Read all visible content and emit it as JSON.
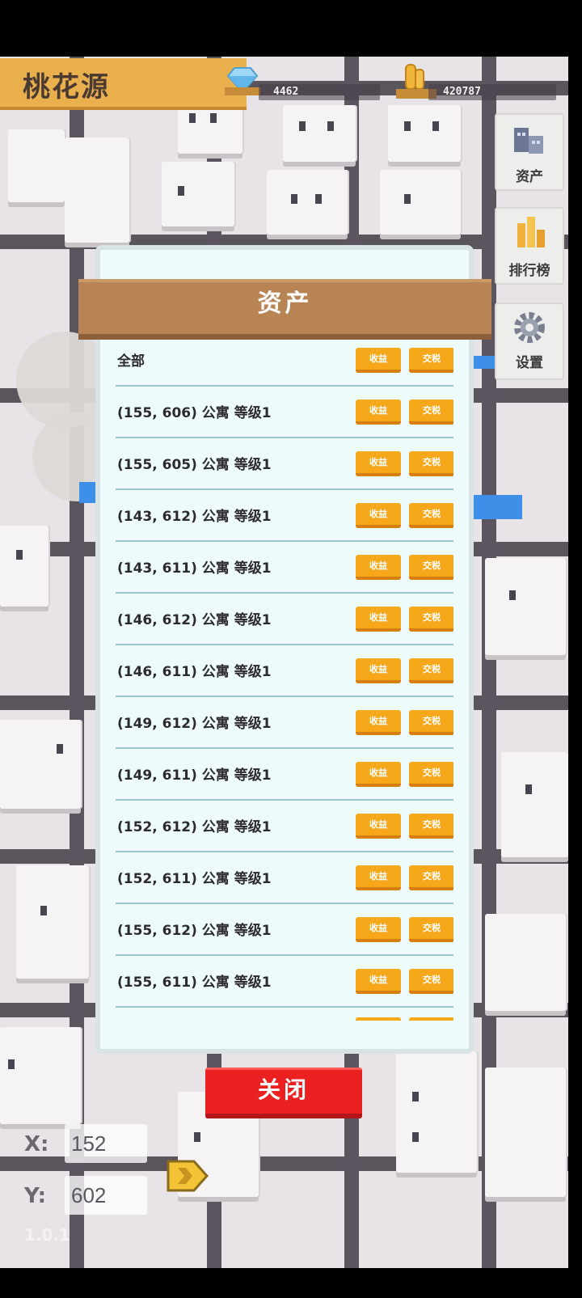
{
  "header": {
    "town_name": "桃花源",
    "diamonds": "4462",
    "gold": "420787"
  },
  "side_menu": {
    "assets_label": "资产",
    "ranking_label": "排行榜",
    "settings_label": "设置"
  },
  "panel": {
    "title": "资产",
    "income_label": "收益",
    "rent_label": "交税",
    "rows": [
      {
        "name": "全部"
      },
      {
        "name": "(155, 606) 公寓 等级1"
      },
      {
        "name": "(155, 605) 公寓 等级1"
      },
      {
        "name": "(143, 612) 公寓 等级1"
      },
      {
        "name": "(143, 611) 公寓 等级1"
      },
      {
        "name": "(146, 612) 公寓 等级1"
      },
      {
        "name": "(146, 611) 公寓 等级1"
      },
      {
        "name": "(149, 612) 公寓 等级1"
      },
      {
        "name": "(149, 611) 公寓 等级1"
      },
      {
        "name": "(152, 612) 公寓 等级1"
      },
      {
        "name": "(152, 611) 公寓 等级1"
      },
      {
        "name": "(155, 612) 公寓 等级1"
      },
      {
        "name": "(155, 611) 公寓 等级1"
      }
    ],
    "close_label": "关闭"
  },
  "coords": {
    "x_label": "X:",
    "x_value": "152",
    "y_label": "Y:",
    "y_value": "602"
  },
  "version": "1.0.1",
  "colors": {
    "button_orange": "#f4a81a",
    "close_red": "#ea2021",
    "panel_brown": "#b88454",
    "header_gold": "#e9b04d"
  }
}
